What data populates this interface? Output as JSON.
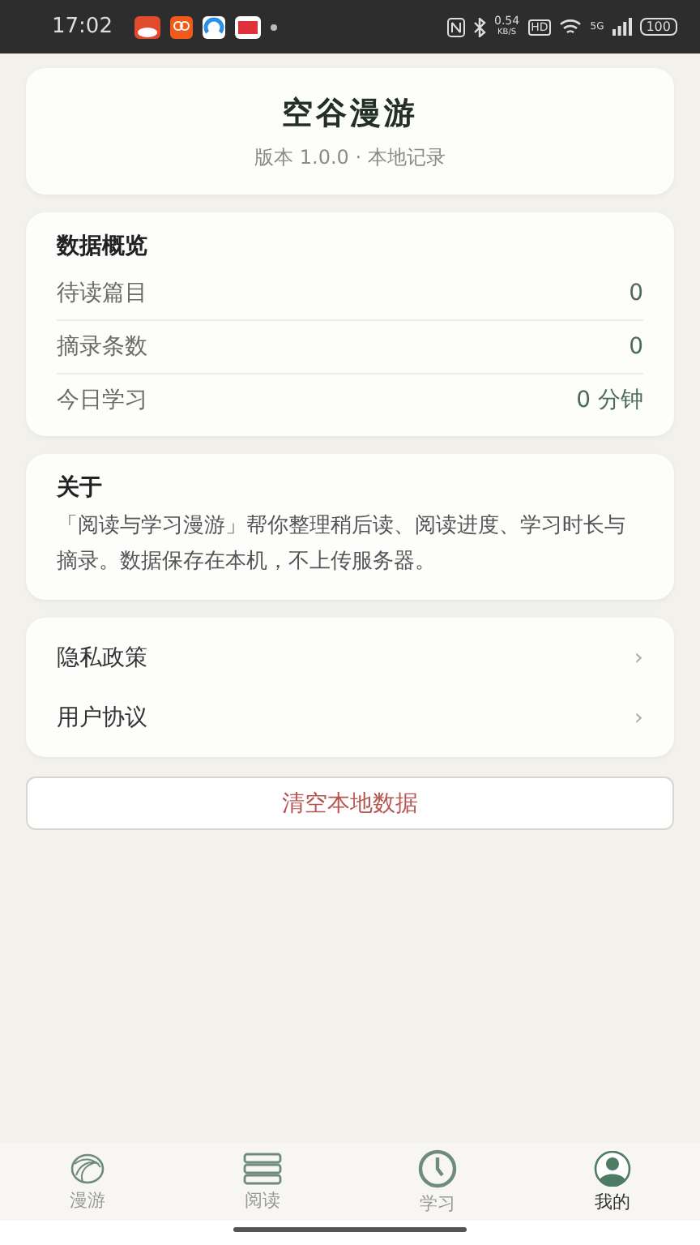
{
  "status_bar": {
    "time": "17:02",
    "speed_value": "0.54",
    "speed_unit": "KB/S",
    "hd": "HD",
    "network": "5G",
    "battery": "100"
  },
  "header": {
    "title": "空谷漫游",
    "subtitle": "版本 1.0.0 · 本地记录"
  },
  "overview": {
    "title": "数据概览",
    "rows": [
      {
        "label": "待读篇目",
        "value": "0"
      },
      {
        "label": "摘录条数",
        "value": "0"
      },
      {
        "label": "今日学习",
        "value": "0 分钟"
      }
    ]
  },
  "about": {
    "title": "关于",
    "text": "「阅读与学习漫游」帮你整理稍后读、阅读进度、学习时长与摘录。数据保存在本机，不上传服务器。"
  },
  "links": [
    {
      "label": "隐私政策",
      "chevron": "›"
    },
    {
      "label": "用户协议",
      "chevron": "›"
    }
  ],
  "clear_button": "清空本地数据",
  "tabs": [
    {
      "kind": "globe",
      "label": "漫游",
      "selected": false
    },
    {
      "kind": "books",
      "label": "阅读",
      "selected": false
    },
    {
      "kind": "clock",
      "label": "学习",
      "selected": false
    },
    {
      "kind": "user",
      "label": "我的",
      "selected": true
    }
  ]
}
